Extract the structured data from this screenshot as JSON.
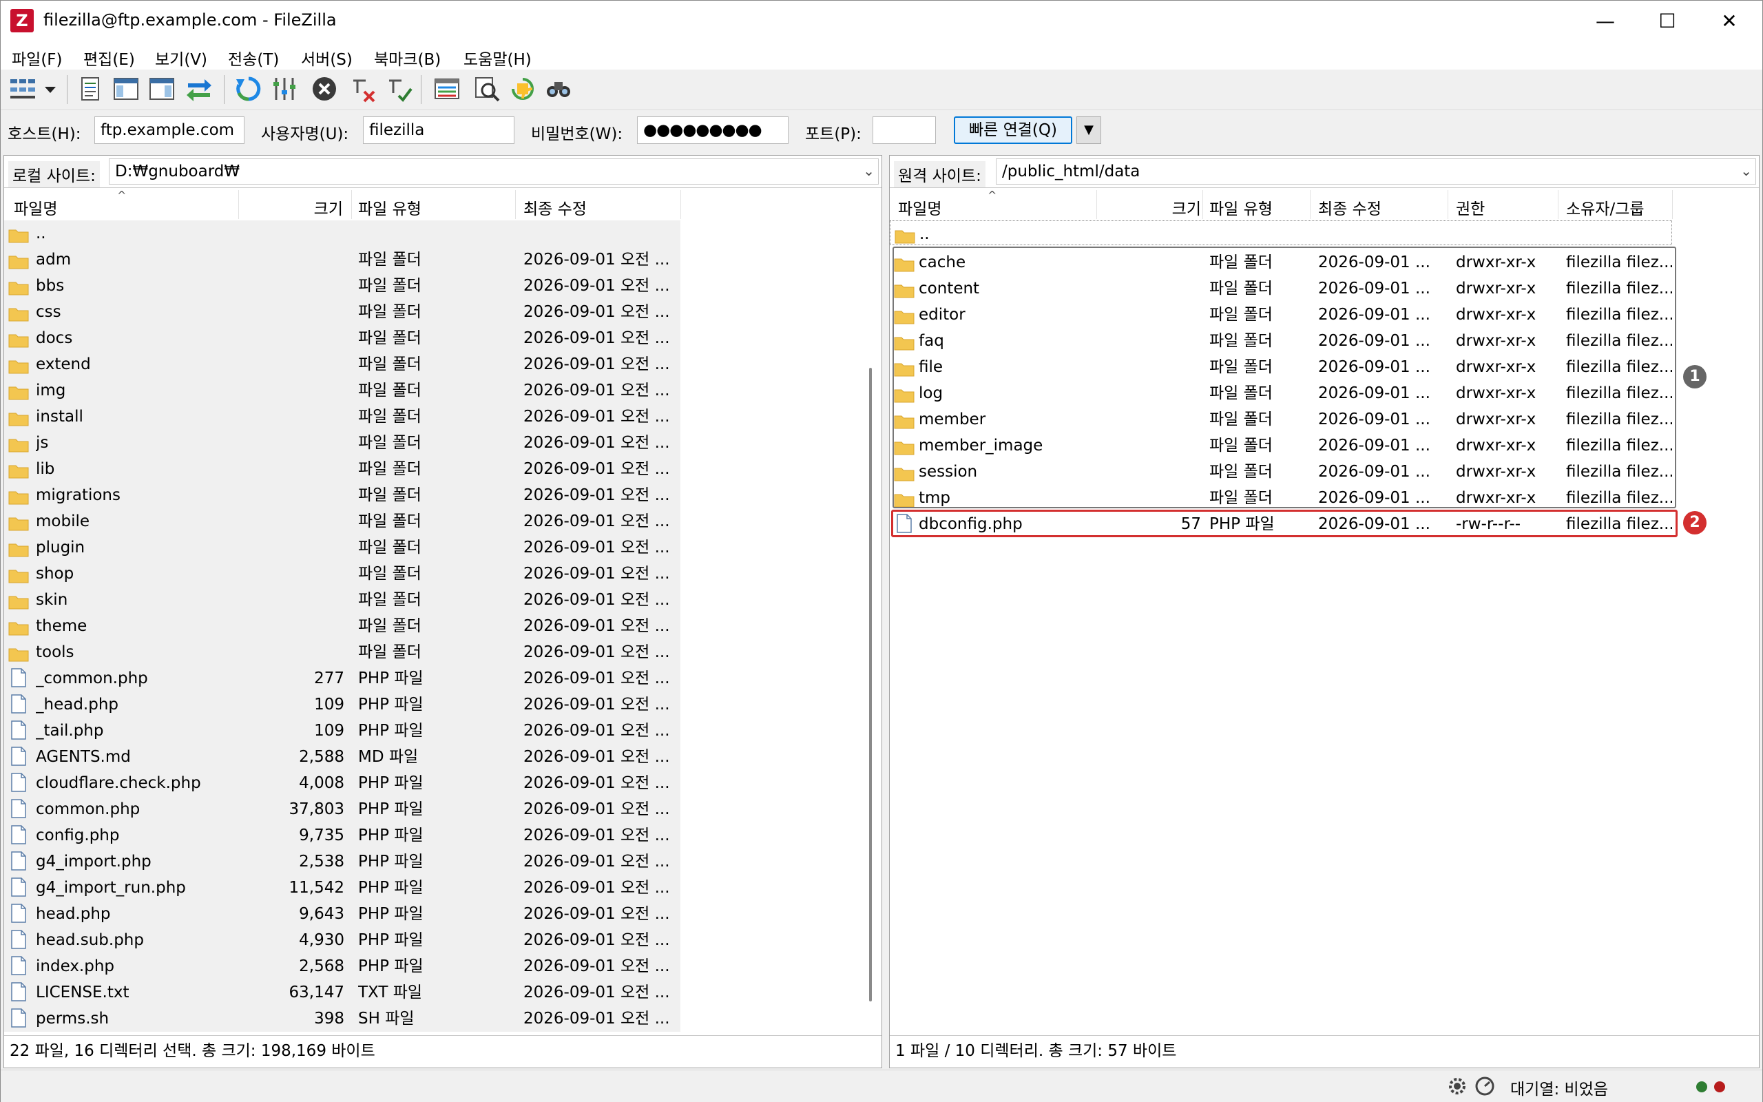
{
  "window": {
    "title": "filezilla@ftp.example.com - FileZilla",
    "app_icon": "Z",
    "minimize": "—",
    "maximize": "☐",
    "close": "✕"
  },
  "menu": [
    "파일(F)",
    "편집(E)",
    "보기(V)",
    "전송(T)",
    "서버(S)",
    "북마크(B)",
    "도움말(H)"
  ],
  "quickconnect": {
    "host_label": "호스트(H):",
    "host_value": "ftp.example.com",
    "user_label": "사용자명(U):",
    "user_value": "filezilla",
    "pass_label": "비밀번호(W):",
    "pass_value": "●●●●●●●●●",
    "port_label": "포트(P):",
    "port_value": "",
    "connect_label": "빠른 연결(Q)",
    "dropdown": "▼"
  },
  "local": {
    "site_label": "로컬 사이트:",
    "path": "D:₩gnuboard₩",
    "columns": [
      "파일명",
      "크기",
      "파일 유형",
      "최종 수정"
    ],
    "rows": [
      {
        "name": "..",
        "size": "",
        "type": "",
        "modified": "",
        "kind": "folder"
      },
      {
        "name": "adm",
        "size": "",
        "type": "파일 폴더",
        "modified": "2026-09-01 오전 ...",
        "kind": "folder"
      },
      {
        "name": "bbs",
        "size": "",
        "type": "파일 폴더",
        "modified": "2026-09-01 오전 ...",
        "kind": "folder"
      },
      {
        "name": "css",
        "size": "",
        "type": "파일 폴더",
        "modified": "2026-09-01 오전 ...",
        "kind": "folder"
      },
      {
        "name": "docs",
        "size": "",
        "type": "파일 폴더",
        "modified": "2026-09-01 오전 ...",
        "kind": "folder"
      },
      {
        "name": "extend",
        "size": "",
        "type": "파일 폴더",
        "modified": "2026-09-01 오전 ...",
        "kind": "folder"
      },
      {
        "name": "img",
        "size": "",
        "type": "파일 폴더",
        "modified": "2026-09-01 오전 ...",
        "kind": "folder"
      },
      {
        "name": "install",
        "size": "",
        "type": "파일 폴더",
        "modified": "2026-09-01 오전 ...",
        "kind": "folder"
      },
      {
        "name": "js",
        "size": "",
        "type": "파일 폴더",
        "modified": "2026-09-01 오전 ...",
        "kind": "folder"
      },
      {
        "name": "lib",
        "size": "",
        "type": "파일 폴더",
        "modified": "2026-09-01 오전 ...",
        "kind": "folder"
      },
      {
        "name": "migrations",
        "size": "",
        "type": "파일 폴더",
        "modified": "2026-09-01 오전 ...",
        "kind": "folder"
      },
      {
        "name": "mobile",
        "size": "",
        "type": "파일 폴더",
        "modified": "2026-09-01 오전 ...",
        "kind": "folder"
      },
      {
        "name": "plugin",
        "size": "",
        "type": "파일 폴더",
        "modified": "2026-09-01 오전 ...",
        "kind": "folder"
      },
      {
        "name": "shop",
        "size": "",
        "type": "파일 폴더",
        "modified": "2026-09-01 오전 ...",
        "kind": "folder"
      },
      {
        "name": "skin",
        "size": "",
        "type": "파일 폴더",
        "modified": "2026-09-01 오전 ...",
        "kind": "folder"
      },
      {
        "name": "theme",
        "size": "",
        "type": "파일 폴더",
        "modified": "2026-09-01 오전 ...",
        "kind": "folder"
      },
      {
        "name": "tools",
        "size": "",
        "type": "파일 폴더",
        "modified": "2026-09-01 오전 ...",
        "kind": "folder"
      },
      {
        "name": "_common.php",
        "size": "277",
        "type": "PHP 파일",
        "modified": "2026-09-01 오전 ...",
        "kind": "file"
      },
      {
        "name": "_head.php",
        "size": "109",
        "type": "PHP 파일",
        "modified": "2026-09-01 오전 ...",
        "kind": "file"
      },
      {
        "name": "_tail.php",
        "size": "109",
        "type": "PHP 파일",
        "modified": "2026-09-01 오전 ...",
        "kind": "file"
      },
      {
        "name": "AGENTS.md",
        "size": "2,588",
        "type": "MD 파일",
        "modified": "2026-09-01 오전 ...",
        "kind": "file"
      },
      {
        "name": "cloudflare.check.php",
        "size": "4,008",
        "type": "PHP 파일",
        "modified": "2026-09-01 오전 ...",
        "kind": "file"
      },
      {
        "name": "common.php",
        "size": "37,803",
        "type": "PHP 파일",
        "modified": "2026-09-01 오전 ...",
        "kind": "file"
      },
      {
        "name": "config.php",
        "size": "9,735",
        "type": "PHP 파일",
        "modified": "2026-09-01 오전 ...",
        "kind": "file"
      },
      {
        "name": "g4_import.php",
        "size": "2,538",
        "type": "PHP 파일",
        "modified": "2026-09-01 오전 ...",
        "kind": "file"
      },
      {
        "name": "g4_import_run.php",
        "size": "11,542",
        "type": "PHP 파일",
        "modified": "2026-09-01 오전 ...",
        "kind": "file"
      },
      {
        "name": "head.php",
        "size": "9,643",
        "type": "PHP 파일",
        "modified": "2026-09-01 오전 ...",
        "kind": "file"
      },
      {
        "name": "head.sub.php",
        "size": "4,930",
        "type": "PHP 파일",
        "modified": "2026-09-01 오전 ...",
        "kind": "file"
      },
      {
        "name": "index.php",
        "size": "2,568",
        "type": "PHP 파일",
        "modified": "2026-09-01 오전 ...",
        "kind": "file"
      },
      {
        "name": "LICENSE.txt",
        "size": "63,147",
        "type": "TXT 파일",
        "modified": "2026-09-01 오전 ...",
        "kind": "file"
      },
      {
        "name": "perms.sh",
        "size": "398",
        "type": "SH 파일",
        "modified": "2026-09-01 오전 ...",
        "kind": "file"
      }
    ],
    "status": "22 파일, 16 디렉터리 선택. 총 크기: 198,169 바이트"
  },
  "remote": {
    "site_label": "원격 사이트:",
    "path": "/public_html/data",
    "columns": [
      "파일명",
      "크기",
      "파일 유형",
      "최종 수정",
      "권한",
      "소유자/그룹"
    ],
    "rows": [
      {
        "name": "..",
        "size": "",
        "type": "",
        "modified": "",
        "perm": "",
        "owner": "",
        "kind": "folder"
      },
      {
        "name": "cache",
        "size": "",
        "type": "파일 폴더",
        "modified": "2026-09-01 ...",
        "perm": "drwxr-xr-x",
        "owner": "filezilla filez...",
        "kind": "folder"
      },
      {
        "name": "content",
        "size": "",
        "type": "파일 폴더",
        "modified": "2026-09-01 ...",
        "perm": "drwxr-xr-x",
        "owner": "filezilla filez...",
        "kind": "folder"
      },
      {
        "name": "editor",
        "size": "",
        "type": "파일 폴더",
        "modified": "2026-09-01 ...",
        "perm": "drwxr-xr-x",
        "owner": "filezilla filez...",
        "kind": "folder"
      },
      {
        "name": "faq",
        "size": "",
        "type": "파일 폴더",
        "modified": "2026-09-01 ...",
        "perm": "drwxr-xr-x",
        "owner": "filezilla filez...",
        "kind": "folder"
      },
      {
        "name": "file",
        "size": "",
        "type": "파일 폴더",
        "modified": "2026-09-01 ...",
        "perm": "drwxr-xr-x",
        "owner": "filezilla filez...",
        "kind": "folder"
      },
      {
        "name": "log",
        "size": "",
        "type": "파일 폴더",
        "modified": "2026-09-01 ...",
        "perm": "drwxr-xr-x",
        "owner": "filezilla filez...",
        "kind": "folder"
      },
      {
        "name": "member",
        "size": "",
        "type": "파일 폴더",
        "modified": "2026-09-01 ...",
        "perm": "drwxr-xr-x",
        "owner": "filezilla filez...",
        "kind": "folder"
      },
      {
        "name": "member_image",
        "size": "",
        "type": "파일 폴더",
        "modified": "2026-09-01 ...",
        "perm": "drwxr-xr-x",
        "owner": "filezilla filez...",
        "kind": "folder"
      },
      {
        "name": "session",
        "size": "",
        "type": "파일 폴더",
        "modified": "2026-09-01 ...",
        "perm": "drwxr-xr-x",
        "owner": "filezilla filez...",
        "kind": "folder"
      },
      {
        "name": "tmp",
        "size": "",
        "type": "파일 폴더",
        "modified": "2026-09-01 ...",
        "perm": "drwxr-xr-x",
        "owner": "filezilla filez...",
        "kind": "folder"
      },
      {
        "name": "dbconfig.php",
        "size": "57",
        "type": "PHP 파일",
        "modified": "2026-09-01 ...",
        "perm": "-rw-r--r--",
        "owner": "filezilla filez...",
        "kind": "file"
      }
    ],
    "status": "1 파일 / 10 디렉터리. 총 크기: 57 바이트"
  },
  "annotations": {
    "badge1": "1",
    "badge2": "2",
    "badge1_color": "#666666",
    "badge2_color": "#d32f2f"
  },
  "queue": {
    "label": "대기열: 비었음"
  },
  "icons": {
    "toolbar": [
      "site-manager-icon",
      "dropdown-icon",
      "message-log-icon",
      "local-tree-icon",
      "remote-tree-icon",
      "transfer-queue-icon",
      "refresh-icon",
      "filter-icon",
      "cancel-icon",
      "disconnect-icon",
      "reconnect-icon",
      "directory-compare-icon",
      "sync-browse-icon",
      "search-remote-icon",
      "find-icon"
    ],
    "status": [
      "settings-icon",
      "speed-limit-icon",
      "led-green-icon",
      "led-red-icon"
    ]
  }
}
